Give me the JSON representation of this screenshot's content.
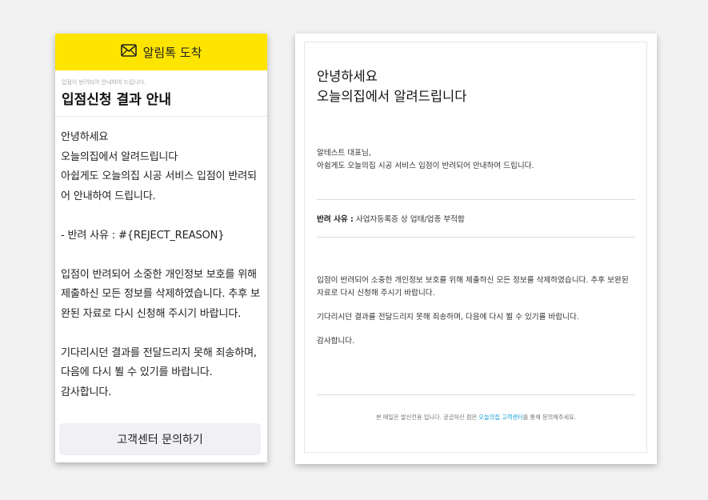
{
  "alimtalk": {
    "header_title": "알림톡 도착",
    "header_icon": "envelope-icon",
    "accent_color": "#fee500",
    "subtitle": "입점이 반려되어 안내하여 드립니다.",
    "title": "입점신청 결과 안내",
    "body": "안녕하세요\n오늘의집에서 알려드립니다\n아쉽게도 오늘의집 시공 서비스 입점이 반려되어 안내하여 드립니다.\n\n- 반려 사유 : #{REJECT_REASON}\n\n입점이 반려되어 소중한 개인정보 보호를 위해 제출하신 모든 정보를 삭제하였습니다. 추후 보완된 자료로 다시 신청해 주시기 바랍니다.\n\n기다리시던 결과를 전달드리지 못해 죄송하며, 다음에 다시 뵐 수 있기를 바랍니다.\n감사합니다.",
    "button_label": "고객센터 문의하기"
  },
  "email": {
    "title_line1": "안녕하세요",
    "title_line2": "오늘의집에서 알려드립니다",
    "greeting_line1": "알테스트 대표님,",
    "greeting_line2": "아쉽게도 오늘의집 시공 서비스 입점이 반려되어 안내하여 드립니다.",
    "reason_label": "반려 사유 :",
    "reason_value": "사업자등록증 상 업태/업종 부적합",
    "paragraph1": "입점이 반려되어 소중한 개인정보 보호를 위해 제출하신 모든 정보를 삭제하였습니다. 추후 보완된 자료로 다시 신청해 주시기 바랍니다.",
    "paragraph2": "기다리시던 결과를 전달드리지 못해 죄송하며, 다음에 다시 뵐 수 있기를 바랍니다.",
    "paragraph3": "감사합니다.",
    "footer_prefix": "본 메일은 발신전용 입니다. 궁금하신 점은 ",
    "footer_link": "오늘의집 고객센터",
    "footer_suffix": "를 통해 문의해주세요.",
    "link_color": "#1aa0d8"
  }
}
